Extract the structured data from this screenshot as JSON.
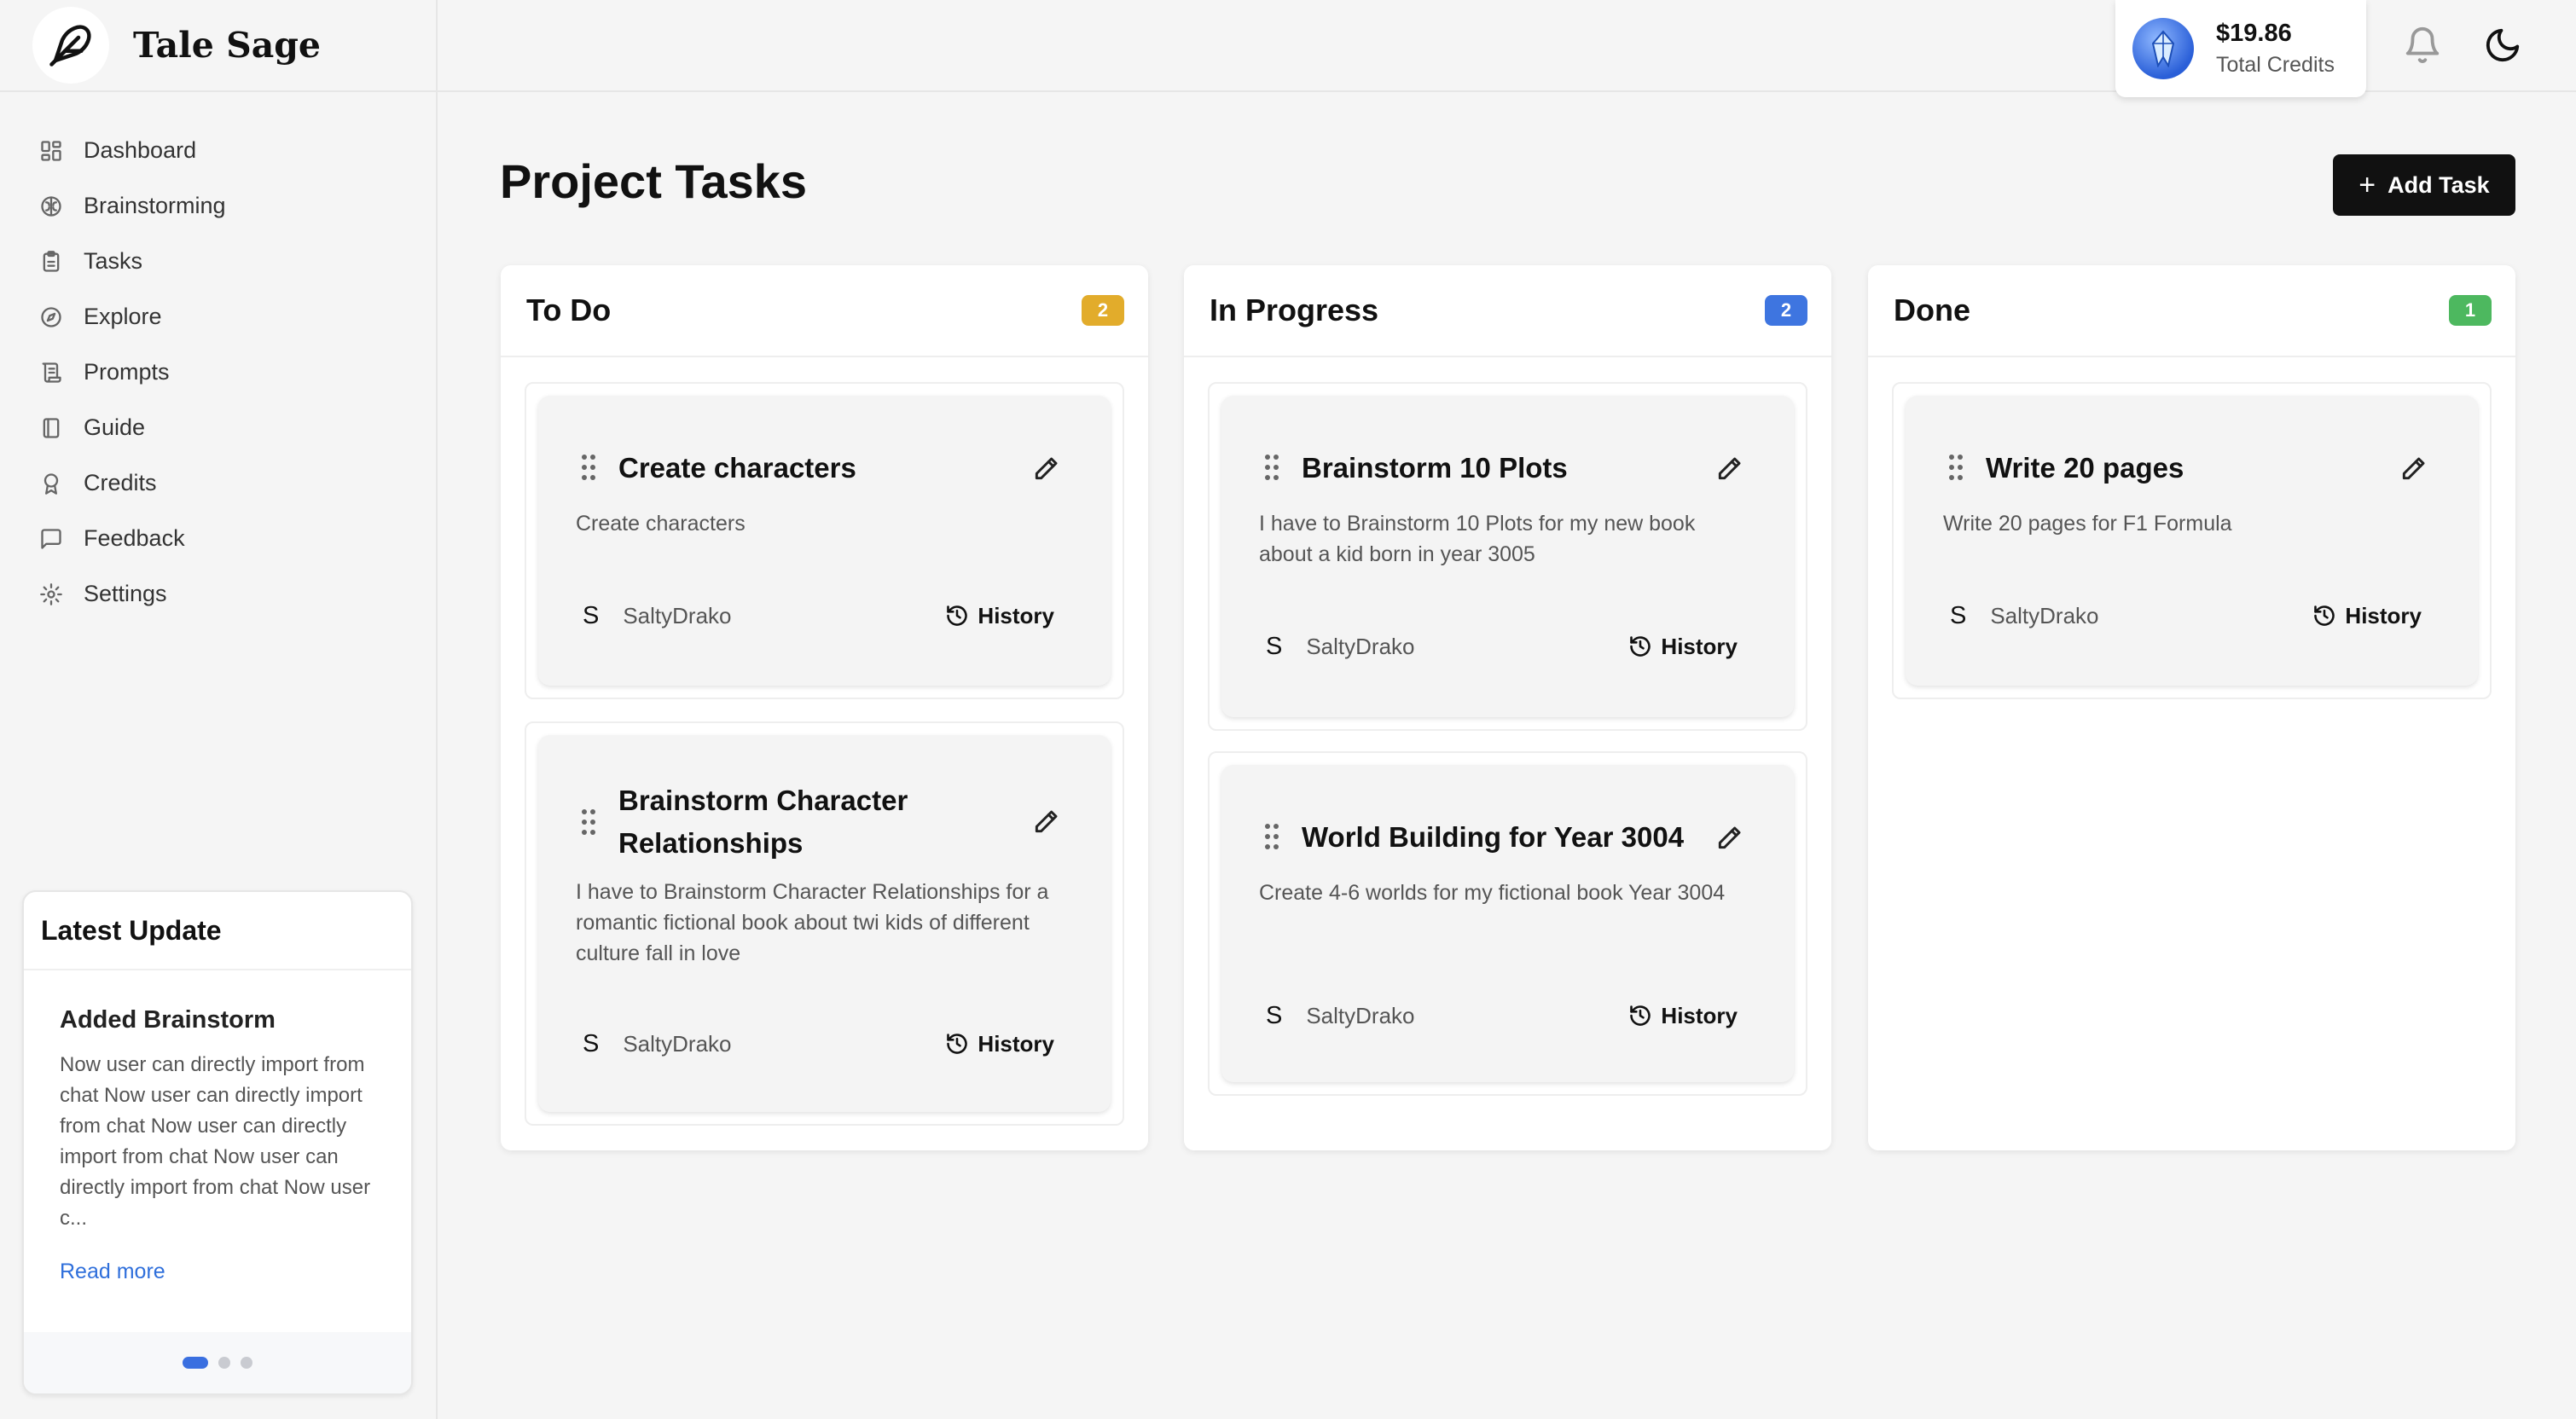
{
  "app": {
    "name": "Tale Sage"
  },
  "sidebar": {
    "items": [
      {
        "label": "Dashboard",
        "icon": "dashboard-icon"
      },
      {
        "label": "Brainstorming",
        "icon": "brain-icon"
      },
      {
        "label": "Tasks",
        "icon": "clipboard-icon"
      },
      {
        "label": "Explore",
        "icon": "compass-icon"
      },
      {
        "label": "Prompts",
        "icon": "scroll-icon"
      },
      {
        "label": "Guide",
        "icon": "book-icon"
      },
      {
        "label": "Credits",
        "icon": "award-icon"
      },
      {
        "label": "Feedback",
        "icon": "message-icon"
      },
      {
        "label": "Settings",
        "icon": "gear-icon"
      }
    ]
  },
  "latest_update": {
    "heading": "Latest Update",
    "title": "Added Brainstorm",
    "text": "Now user can directly import from chat Now user can directly import from chat Now user can directly import from chat Now user can directly import from chat Now user c...",
    "read_more": "Read more",
    "slides": 3,
    "active_slide": 1
  },
  "header": {
    "credits_amount": "$19.86",
    "credits_label": "Total Credits"
  },
  "main": {
    "title": "Project Tasks",
    "add_task_label": "Add Task",
    "columns": [
      {
        "title": "To Do",
        "count": "2",
        "badge_color": "#e2ac2b",
        "tasks": [
          {
            "title": "Create characters",
            "description": "Create characters",
            "user_initial": "S",
            "user": "SaltyDrako",
            "history": "History"
          },
          {
            "title": "Brainstorm Character Relationships",
            "description": "I have to Brainstorm Character Relationships for a romantic fictional book about twi kids of different culture fall in love",
            "user_initial": "S",
            "user": "SaltyDrako",
            "history": "History"
          }
        ]
      },
      {
        "title": "In Progress",
        "count": "2",
        "badge_color": "#3e75e0",
        "tasks": [
          {
            "title": "Brainstorm 10 Plots",
            "description": "I have to Brainstorm 10 Plots for my new book about a kid born in year 3005",
            "user_initial": "S",
            "user": "SaltyDrako",
            "history": "History"
          },
          {
            "title": "World Building for Year 3004",
            "description": "Create 4-6 worlds for my fictional book Year 3004",
            "user_initial": "S",
            "user": "SaltyDrako",
            "history": "History"
          }
        ]
      },
      {
        "title": "Done",
        "count": "1",
        "badge_color": "#4db85f",
        "tasks": [
          {
            "title": "Write 20 pages",
            "description": "Write 20 pages for F1 Formula",
            "user_initial": "S",
            "user": "SaltyDrako",
            "history": "History"
          }
        ]
      }
    ]
  }
}
